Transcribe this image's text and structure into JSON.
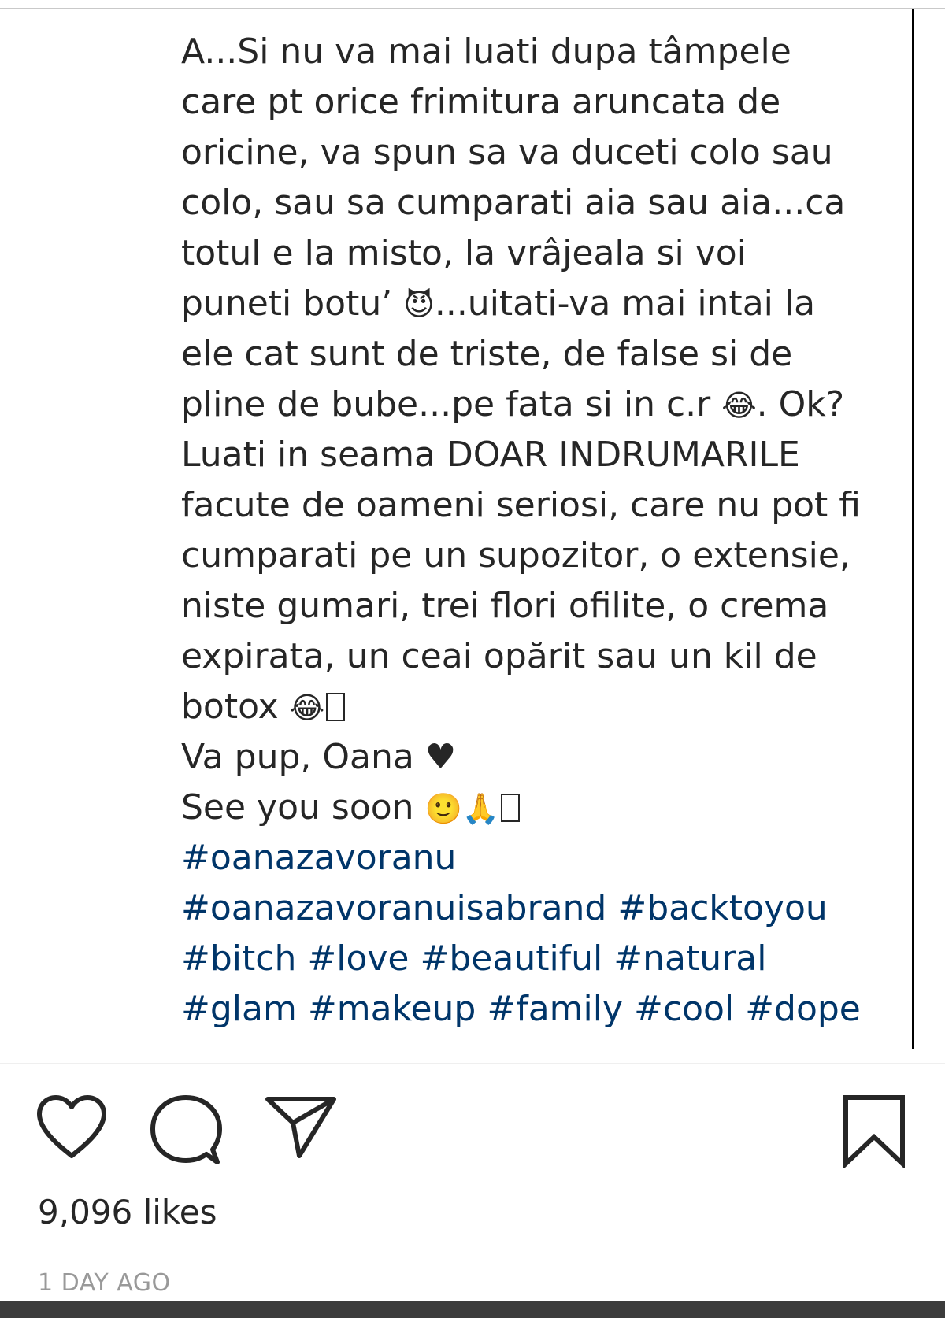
{
  "post": {
    "caption_lines": [
      "A...Si nu va mai luati dupa tâmpele",
      "care pt orice frimitura aruncata de",
      "oricine, va spun sa va duceti colo sau",
      "colo, sau sa cumparati aia sau aia...ca",
      "totul e la misto, la vrâjeala si voi",
      "...uitati-va mai intai la",
      "ele cat sunt de triste, de false si de",
      "pline de bube...pe fata si in c.r",
      ". Ok?",
      "Luati in seama DOAR INDRUMARILE",
      "facute de oameni seriosi, care nu pot fi",
      "cumparati pe un supozitor, o extensie,",
      "niste gumari, trei flori ofilite, o crema",
      "expirata, un ceai opărit sau un kil de",
      "botox",
      "Va pup, Oana",
      "See you soon"
    ],
    "puneti_prefix": "puneti botu’",
    "emojis": {
      "devil": "😈",
      "laugh": "😂",
      "heart": "♥",
      "smile": "🙂",
      "pray": "🙏"
    },
    "hashtag_lines": [
      [
        "#oanazavoranu"
      ],
      [
        "#oanazavoranuisabrand",
        "#backtoyou"
      ],
      [
        "#bitch",
        "#love",
        "#beautiful",
        "#natural"
      ],
      [
        "#glam",
        "#makeup",
        "#family",
        "#cool",
        "#dope"
      ]
    ],
    "likes": "9,096 likes",
    "timestamp": "1 DAY AGO"
  },
  "icons": {
    "like": "heart-outline-icon",
    "comment": "comment-bubble-icon",
    "share": "paper-plane-icon",
    "save": "bookmark-icon"
  },
  "colors": {
    "text": "#262626",
    "hashtag": "#003569",
    "timestamp": "#999999"
  }
}
